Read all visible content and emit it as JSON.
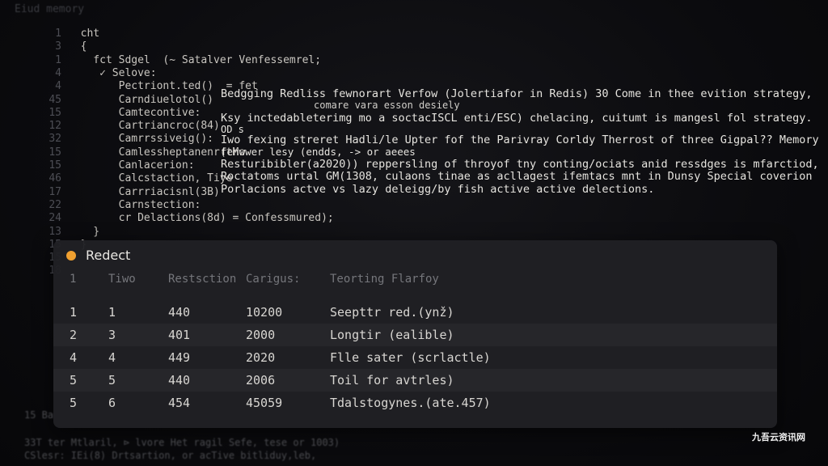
{
  "window": {
    "title": "Eiud memory"
  },
  "editor": {
    "lines": [
      {
        "num": "1",
        "text": "  cht",
        "kind": "kw"
      },
      {
        "num": "3",
        "text": "  {",
        "kind": "dim"
      },
      {
        "num": "1",
        "text": "    fct Sdgel  (~ Satalver Venfessemrel;",
        "kind": "mixed"
      },
      {
        "num": "4",
        "text": "     ✓ Selove:",
        "kind": "fn"
      },
      {
        "num": "4",
        "text": "        Pectriont.ted()  = fet",
        "kind": "mixed"
      },
      {
        "num": "45",
        "text": "        Carndiuelotol()",
        "kind": "code"
      },
      {
        "num": "15",
        "text": "        Camtecontive:",
        "kind": "code"
      },
      {
        "num": "12",
        "text": "        Cartriancroc(84)",
        "kind": "code"
      },
      {
        "num": "32",
        "text": "        Camrrssiveig():",
        "kind": "code"
      },
      {
        "num": "15",
        "text": "        Camlessheptanenr(tMo",
        "kind": "code"
      },
      {
        "num": "15",
        "text": "        Canlacerion:",
        "kind": "code"
      },
      {
        "num": "46",
        "text": "        Calcstaction, Tiye",
        "kind": "code"
      },
      {
        "num": "17",
        "text": "        Carrriacisnl(3B)",
        "kind": "code"
      },
      {
        "num": "22",
        "text": "        Carnstection:",
        "kind": "code"
      },
      {
        "num": "24",
        "text": "        cr Delactions(8d) = Confessmured);",
        "kind": "mixed"
      },
      {
        "num": "13",
        "text": "    }",
        "kind": "dim"
      },
      {
        "num": "15",
        "text": "  }",
        "kind": "dim"
      },
      {
        "num": "15",
        "text": "",
        "kind": "dim"
      },
      {
        "num": "18",
        "text": "",
        "kind": "dim"
      }
    ],
    "overlay": [
      "Bedgging Redliss fewnorart Verfow (Jolertiafor in Redis) 30 Come in thee evition strategy,",
      "comare vara esson desiely",
      "Ksy inctedableterimg mo a soctacISCL enti/ESC) chelacing, cuitumt is mangesl fol strategy.",
      "OD       s",
      "Iwo fexing streret Hadli/le Upter fof the Parivray Corldy Therrost of three Gigpal?? Memory",
      "fenwwer lesy (endds, -> or aeees",
      "Resturibibler(a2020)) reppersling of throyof tny conting/ociats anid ressdges is mfarctiod,",
      "Roctatoms urtal GM(1308, culaons tinae as acllagest ifemtacs mnt in Dunsy Special coverion",
      "Porlacions actve vs lazy deleigg/by fish active active delections."
    ]
  },
  "panel": {
    "title": "Redect",
    "status_color": "#f0a030",
    "columns": [
      "1",
      "Tiwo",
      "Restsction",
      "Carigus:",
      "Teorting Flarfoy"
    ],
    "rows": [
      [
        "1",
        "1",
        "440",
        "10200",
        "Seepttr red.(ynž)"
      ],
      [
        "2",
        "3",
        "401",
        "2000",
        "Longtir (ealible)"
      ],
      [
        "4",
        "4",
        "449",
        "2020",
        "Flle sater (scrlactle)"
      ],
      [
        "5",
        "5",
        "440",
        "2006",
        "Toil for avtrles)"
      ],
      [
        "5",
        "6",
        "454",
        "45059",
        "Tdalstogynes.(ate.457)"
      ]
    ]
  },
  "footer_code": [
    "15  Ba",
    "33T  ter  Mtlaril,  ⊳ lvore Het ragil Sefe, tese or 1003)",
    "CSlesr:  IEi(8) Drtsartion, or acTive bitliduy,leb,"
  ],
  "watermark": "九吾云资讯网"
}
